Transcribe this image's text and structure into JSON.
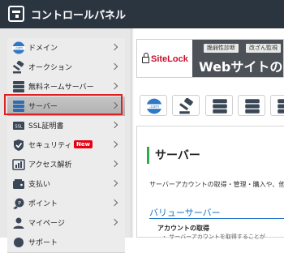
{
  "header": {
    "title": "コントロールパネル"
  },
  "sidebar": {
    "items": [
      {
        "label": "ドメイン",
        "icon": "domain-com-icon"
      },
      {
        "label": "オークション",
        "icon": "gavel-icon"
      },
      {
        "label": "無料ネームサーバー",
        "icon": "server-stack-icon"
      },
      {
        "label": "サーバー",
        "icon": "server-stack-icon",
        "active": true
      },
      {
        "label": "SSL証明書",
        "icon": "ssl-icon"
      },
      {
        "label": "セキュリティ",
        "icon": "shield-icon",
        "badge": "New"
      },
      {
        "label": "アクセス解析",
        "icon": "chart-icon"
      },
      {
        "label": "支払い",
        "icon": "wallet-icon"
      },
      {
        "label": "ポイント",
        "icon": "point-coin-icon"
      },
      {
        "label": "マイページ",
        "icon": "person-icon"
      },
      {
        "label": "サポート",
        "icon": "support-icon"
      }
    ]
  },
  "banner": {
    "brand": "SiteLock",
    "tags": [
      "脆弱性診断",
      "改ざん監視"
    ],
    "headline": "Webサイトの安"
  },
  "icon_row": [
    "domain-com-icon",
    "gavel-icon",
    "server-stack-icon",
    "server-stack-icon",
    "server-stack-icon"
  ],
  "main": {
    "title": "サーバー",
    "description": "サーバーアカウントの取得・管理・購入や、他",
    "section_title": "バリューサーバー",
    "list_head": "アカウントの取得",
    "list_text": "・ サーバーアカウントを取得することが"
  },
  "colors": {
    "header_bg": "#2b3540",
    "accent_green": "#2eaa4e",
    "link_blue": "#1a73c8",
    "highlight_red": "#e02020",
    "badge_red": "#e60012"
  }
}
